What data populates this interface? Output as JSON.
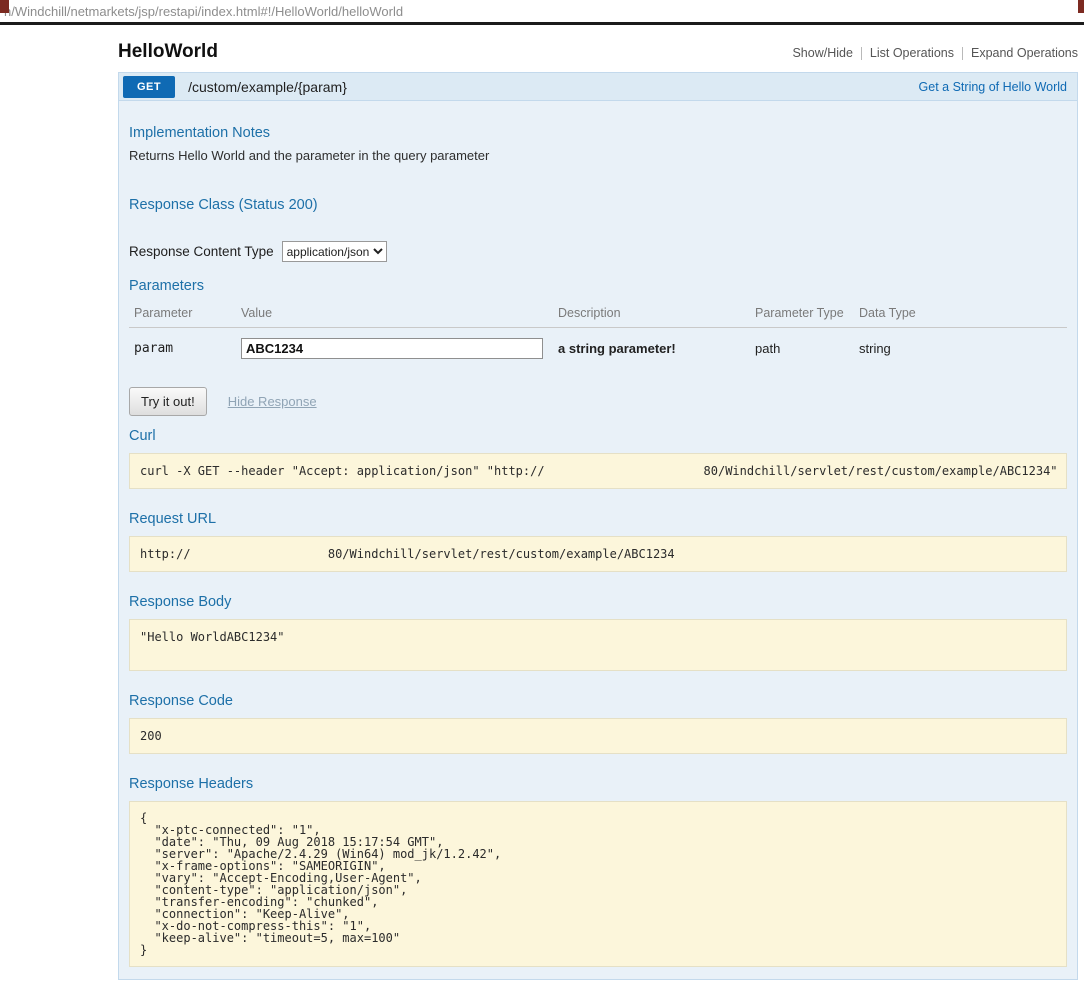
{
  "browser": {
    "url": "n/Windchill/netmarkets/jsp/restapi/index.html#!/HelloWorld/helloWorld"
  },
  "header": {
    "title": "HelloWorld",
    "actions": [
      {
        "label": "Show/Hide"
      },
      {
        "label": "List Operations"
      },
      {
        "label": "Expand Operations"
      }
    ]
  },
  "operation": {
    "method": "GET",
    "path": "/custom/example/{param}",
    "summary_link": "Get a String of Hello World",
    "implementation_notes": {
      "heading": "Implementation Notes",
      "text": "Returns Hello World and the parameter in the query parameter"
    },
    "response_class": {
      "heading": "Response Class (Status 200)"
    },
    "response_content_type": {
      "label": "Response Content Type",
      "selected": "application/json"
    },
    "parameters": {
      "heading": "Parameters",
      "columns": [
        "Parameter",
        "Value",
        "Description",
        "Parameter Type",
        "Data Type"
      ],
      "rows": [
        {
          "name": "param",
          "value": "ABC1234",
          "description": "a string parameter!",
          "param_type": "path",
          "data_type": "string"
        }
      ]
    },
    "try_button": "Try it out!",
    "hide_response": "Hide Response",
    "curl": {
      "heading": "Curl",
      "command": "curl -X GET --header \"Accept: application/json\" \"http://                      80/Windchill/servlet/rest/custom/example/ABC1234\""
    },
    "request_url": {
      "heading": "Request URL",
      "value": "http://                   80/Windchill/servlet/rest/custom/example/ABC1234"
    },
    "response_body": {
      "heading": "Response Body",
      "value": "\"Hello WorldABC1234\""
    },
    "response_code": {
      "heading": "Response Code",
      "value": "200"
    },
    "response_headers": {
      "heading": "Response Headers",
      "value": "{\n  \"x-ptc-connected\": \"1\",\n  \"date\": \"Thu, 09 Aug 2018 15:17:54 GMT\",\n  \"server\": \"Apache/2.4.29 (Win64) mod_jk/1.2.42\",\n  \"x-frame-options\": \"SAMEORIGIN\",\n  \"vary\": \"Accept-Encoding,User-Agent\",\n  \"content-type\": \"application/json\",\n  \"transfer-encoding\": \"chunked\",\n  \"connection\": \"Keep-Alive\",\n  \"x-do-not-compress-this\": \"1\",\n  \"keep-alive\": \"timeout=5, max=100\"\n}"
    }
  },
  "colors": {
    "method_get": "#0f6ab4",
    "heading_blue": "#1d70a8",
    "panel_bg": "#e9f1f8",
    "panel_header_bg": "#dceaf4",
    "panel_border": "#c3d9ec",
    "code_bg": "#fcf6db",
    "code_border": "#e5e0c6"
  }
}
